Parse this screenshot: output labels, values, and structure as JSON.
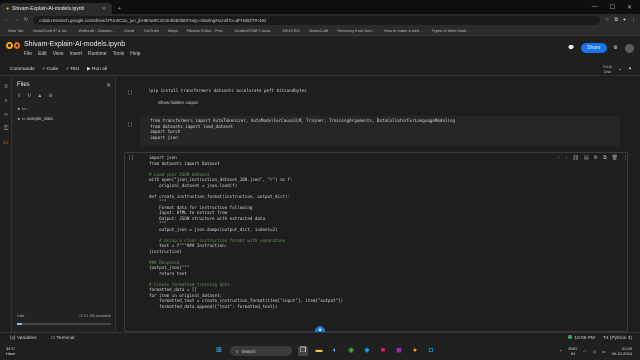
{
  "browser": {
    "tab_title": "Shivam-Explain-AI-models.ipynb",
    "url": "colab.research.google.com/drive/1PUn0C2x_jun_jkH8Hw0C4CSnhbb0l5t0?usp=sharing#scrollTo=dFHd0Z7PcNG",
    "bookmarks": [
      "New Tab",
      "VisionCraft IP & Int...",
      "Wolfcraft - Dashbo...",
      "Gmail",
      "YouTube",
      "Maps",
      "Pikselo Editor - Prot...",
      "DeathAIT/NET Accu...",
      "DEXCRO",
      "VisionCraft",
      "Recovery from Dea...",
      "How to make a web...",
      "Types of Web Hosti..."
    ]
  },
  "colab": {
    "notebook_title": "Shivam-Explain-AI-models.ipynb",
    "menu": [
      "File",
      "Edit",
      "View",
      "Insert",
      "Runtime",
      "Tools",
      "Help"
    ],
    "share_label": "Share",
    "toolbar": {
      "commands": "Commands",
      "code": "+ Code",
      "text": "+ Text",
      "run_all": "▶ Run all",
      "ram": "RAM",
      "disk": "Disk"
    }
  },
  "files_panel": {
    "title": "Files",
    "items": [
      "..",
      "sample_data"
    ],
    "disk_text": "Disk",
    "disk_value": "72.21 GB available",
    "disk_fraction": 0.05
  },
  "cells": {
    "cell1_code": "!pip install transformers datasets accelerate peft bitsandbytes",
    "cell1_output": "Show hidden output",
    "cell2_lines": [
      "from transformers import AutoTokenizer, AutoModelForCausalLM, Trainer, TrainingArguments, DataCollatorForLanguageModeling",
      "from datasets import load_dataset",
      "import torch",
      "import json"
    ],
    "cell3_lines": [
      "import json",
      "from datasets import Dataset",
      "",
      "# Load your JSON dataset",
      "with open(\"json_instruction_dataset_100.json\", \"r\") as f:",
      "    original_dataset = json.load(f)",
      "",
      "def create_instruction_format(instruction, output_dict):",
      "    \"\"\"",
      "    Format data for instruction following",
      "    Input: HTML to extract from",
      "    Output: JSON structure with extracted data",
      "    \"\"\"",
      "    output_json = json.dumps(output_dict, indent=2)",
      "",
      "    # Using a clear instruction format with separation",
      "    text = f\"\"\"### Instruction:",
      "{instruction}",
      "",
      "### Response:",
      "{output_json}\"\"\"",
      "    return text",
      "",
      "# Create formatted training data",
      "formatted_data = []",
      "for item in original_dataset:",
      "    formatted_text = create_instruction_format(item[\"input\"], item[\"output\"])",
      "    formatted_data.append({\"text\": formatted_text})"
    ]
  },
  "statusbar": {
    "variables": "Variables",
    "terminal": "Terminal",
    "status": "10:09 PM",
    "runtime": "T4 (Python 3)"
  },
  "taskbar": {
    "weather_temp": "34°C",
    "weather_desc": "Haze",
    "search": "Search",
    "lang": "ENG",
    "lang2": "IN",
    "time": "22:09",
    "date": "06-10-2024"
  }
}
